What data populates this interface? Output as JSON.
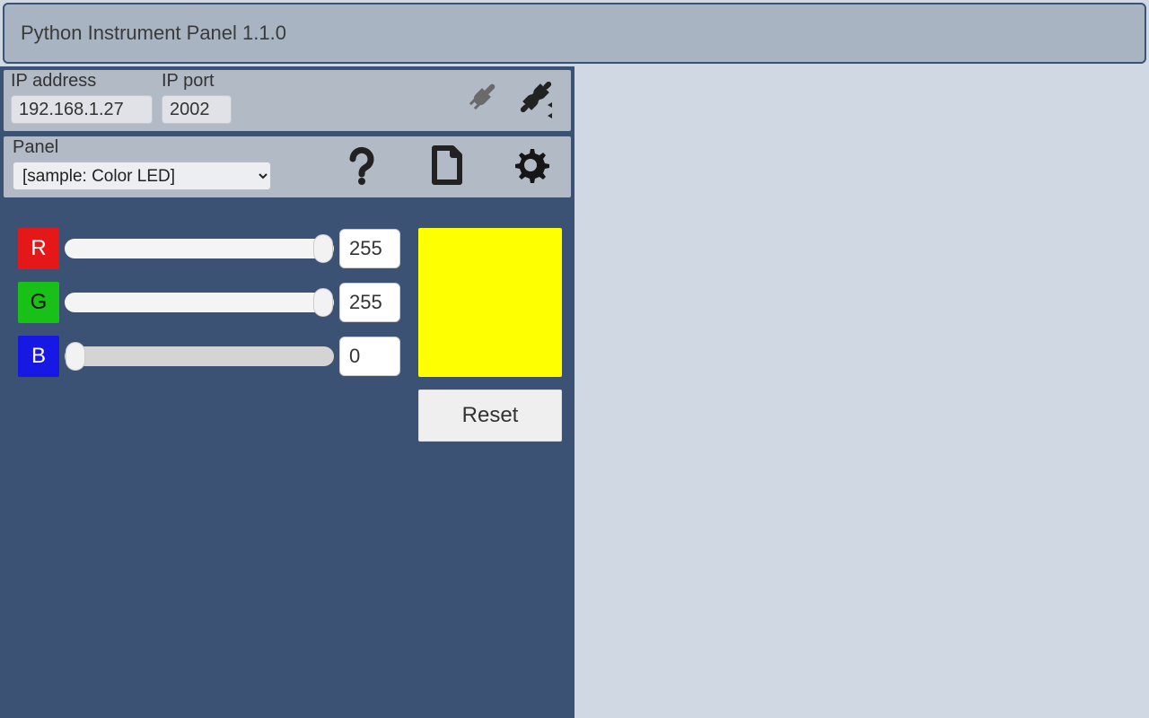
{
  "app": {
    "title": "Python Instrument Panel 1.1.0"
  },
  "connection": {
    "ip_label": "IP address",
    "ip_value": "192.168.1.27",
    "port_label": "IP port",
    "port_value": "2002"
  },
  "panel": {
    "label": "Panel",
    "selected": "[sample: Color LED]"
  },
  "sliders": {
    "r": {
      "letter": "R",
      "value": "255",
      "pct": 100
    },
    "g": {
      "letter": "G",
      "value": "255",
      "pct": 100
    },
    "b": {
      "letter": "B",
      "value": "0",
      "pct": 0
    }
  },
  "preview_color": "#feff00",
  "reset_label": "Reset",
  "icons": {
    "connect": "plug-connect-icon",
    "disconnect": "plug-disconnect-icon",
    "help": "help-icon",
    "file": "file-icon",
    "settings": "gear-icon"
  }
}
